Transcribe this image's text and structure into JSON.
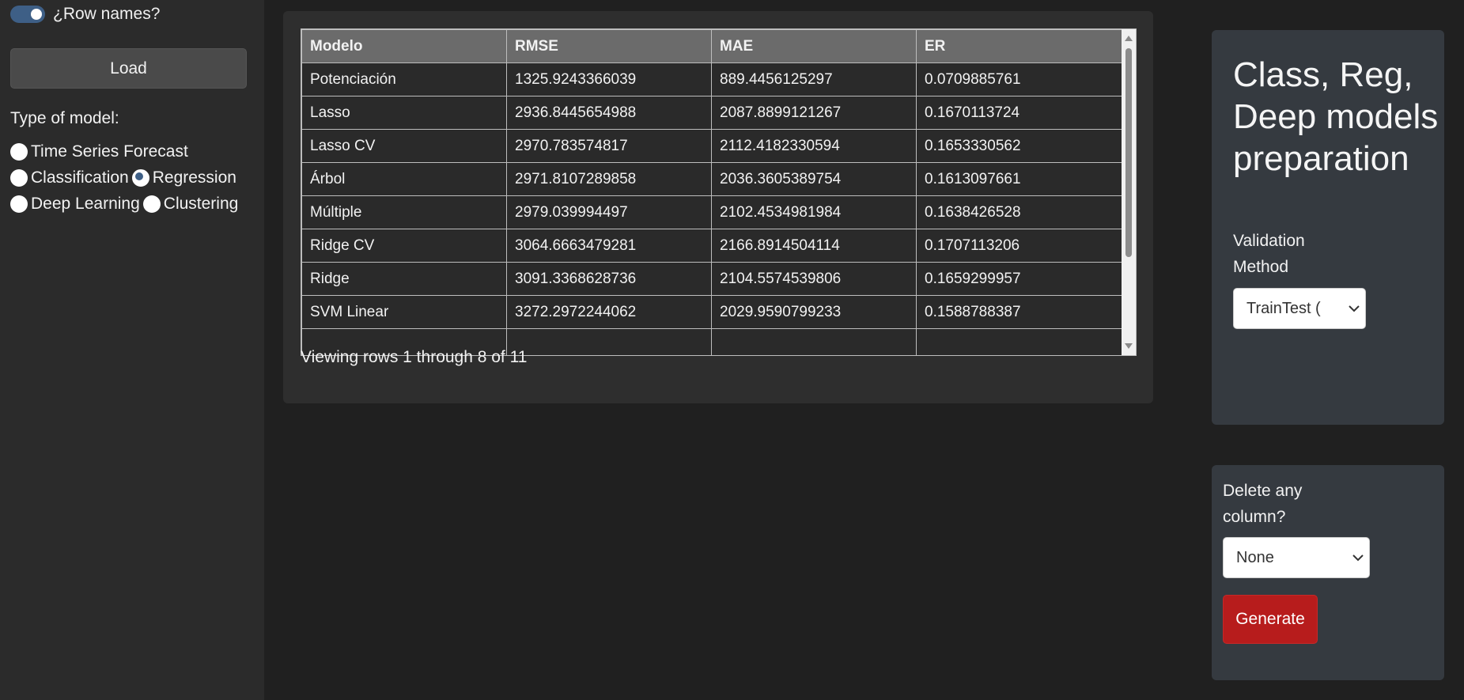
{
  "sidebar": {
    "row_names_label": "¿Row names?",
    "load_label": "Load",
    "model_type_label": "Type of model:",
    "model_options": [
      "Time Series Forecast",
      "Classification",
      "Regression",
      "Deep Learning",
      "Clustering"
    ],
    "selected_model": "Regression"
  },
  "table": {
    "columns": [
      "Modelo",
      "RMSE",
      "MAE",
      "ER"
    ],
    "rows": [
      [
        "Potenciación",
        "1325.9243366039",
        "889.4456125297",
        "0.0709885761"
      ],
      [
        "Lasso",
        "2936.8445654988",
        "2087.8899121267",
        "0.1670113724"
      ],
      [
        "Lasso CV",
        "2970.783574817",
        "2112.4182330594",
        "0.1653330562"
      ],
      [
        "Árbol",
        "2971.8107289858",
        "2036.3605389754",
        "0.1613097661"
      ],
      [
        "Múltiple",
        "2979.039994497",
        "2102.4534981984",
        "0.1638426528"
      ],
      [
        "Ridge CV",
        "3064.6663479281",
        "2166.8914504114",
        "0.1707113206"
      ],
      [
        "Ridge",
        "3091.3368628736",
        "2104.5574539806",
        "0.1659299957"
      ],
      [
        "SVM Linear",
        "3272.2972244062",
        "2029.9590799233",
        "0.1588788387"
      ]
    ],
    "status": "Viewing rows 1 through 8 of 11"
  },
  "panel": {
    "title": "Class, Reg, Deep models preparation",
    "validation_label": "Validation Method",
    "validation_value": "TrainTest (",
    "delete_label": "Delete any column?",
    "delete_value": "None",
    "generate_label": "Generate"
  },
  "colors": {
    "accent": "#3e5f86",
    "generate": "#b71c1c"
  }
}
